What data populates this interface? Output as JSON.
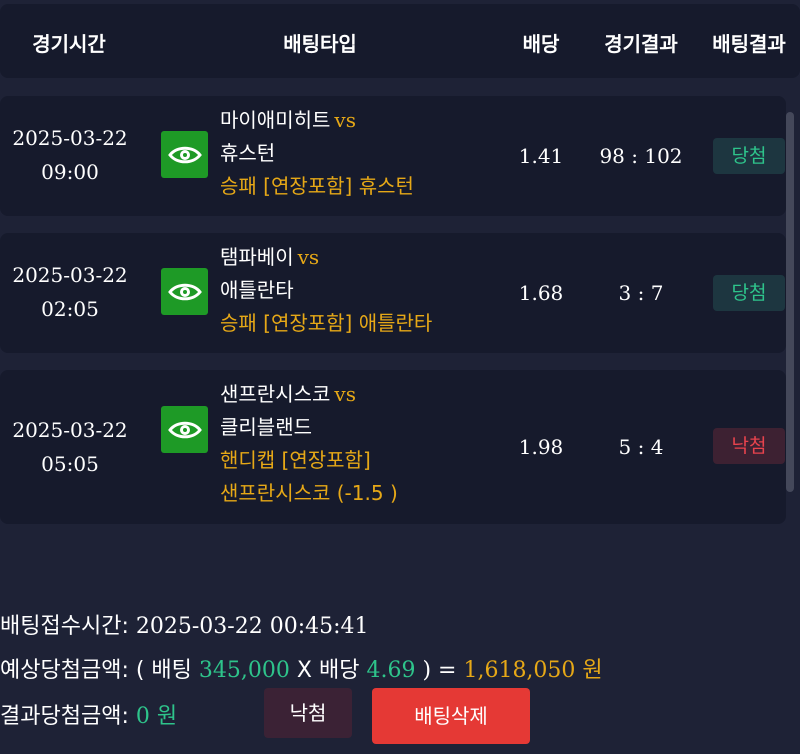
{
  "header": {
    "time": "경기시간",
    "type": "배팅타입",
    "odds": "배당",
    "score": "경기결과",
    "result": "배팅결과"
  },
  "games": [
    {
      "date": "2025-03-22",
      "time": "09:00",
      "home": "마이애미히트",
      "vs": "vs",
      "away": "휴스턴",
      "bet_lines": [
        "승패 [연장포함] 휴스턴"
      ],
      "odds": "1.41",
      "score": "98 : 102",
      "result": "당첨",
      "result_state": "win"
    },
    {
      "date": "2025-03-22",
      "time": "02:05",
      "home": "탬파베이",
      "vs": "vs",
      "away": "애틀란타",
      "bet_lines": [
        "승패 [연장포함] 애틀란타"
      ],
      "odds": "1.68",
      "score": "3 : 7",
      "result": "당첨",
      "result_state": "win"
    },
    {
      "date": "2025-03-22",
      "time": "05:05",
      "home": "샌프란시스코",
      "vs": "vs",
      "away": "클리블랜드",
      "bet_lines": [
        "핸디캡 [연장포함]",
        "샌프란시스코 (-1.5 )"
      ],
      "odds": "1.98",
      "score": "5 : 4",
      "result": "낙첨",
      "result_state": "lose"
    }
  ],
  "summary": {
    "received_label": "배팅접수시간:",
    "received_value": "2025-03-22 00:45:41",
    "expected_label": "예상당첨금액:",
    "open_paren": "( 배팅",
    "bet_amount": "345,000",
    "times": "X 배당",
    "total_odds": "4.69",
    "close_eq": ") =",
    "expected_amount": "1,618,050 원",
    "result_label": "결과당첨금액:",
    "result_amount": "0 원",
    "lose_button": "낙첨",
    "delete_button": "배팅삭제"
  },
  "colors": {
    "background": "#1e2236",
    "card": "#161a2c",
    "accent_gold": "#e6a817",
    "win_green": "#2ec48b",
    "lose_red": "#e8434d",
    "eye_button": "#1e9a26",
    "delete_button": "#e53935"
  },
  "icons": [
    "eye-icon"
  ]
}
